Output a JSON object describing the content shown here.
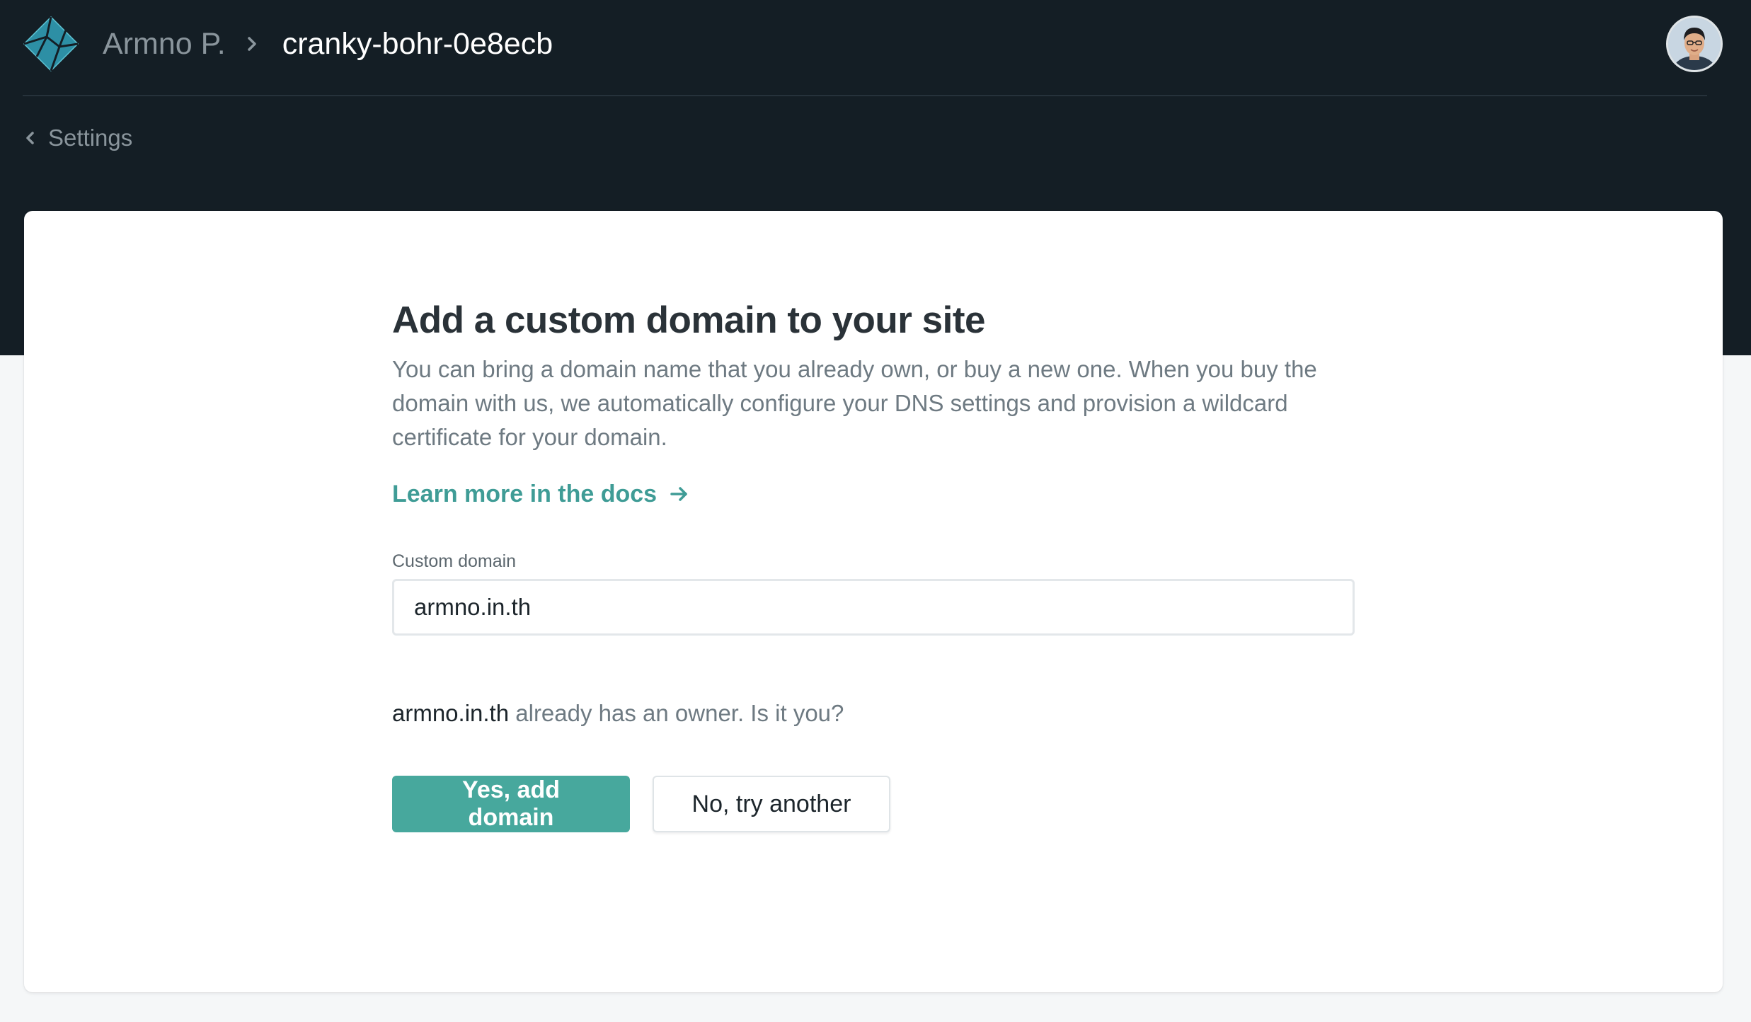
{
  "header": {
    "team_name": "Armno P.",
    "site_name": "cranky-bohr-0e8ecb",
    "logo_icon": "netlify-logo-icon",
    "avatar_alt": "user avatar"
  },
  "nav": {
    "back_label": "Settings"
  },
  "main": {
    "heading": "Add a custom domain to your site",
    "description": "You can bring a domain name that you already own, or buy a new one. When you buy the domain with us, we automatically configure your DNS settings and provision a wildcard certificate for your domain.",
    "docs_link": "Learn more in the docs",
    "domain_field": {
      "label": "Custom domain",
      "value": "armno.in.th"
    },
    "owner_check": {
      "domain": "armno.in.th",
      "message": " already has an owner. Is it you?"
    },
    "buttons": {
      "confirm": "Yes, add domain",
      "decline": "No, try another"
    }
  },
  "colors": {
    "header_bg": "#141e25",
    "page_bg": "#f5f7f8",
    "accent": "#47a89d",
    "link": "#3f9c96"
  }
}
